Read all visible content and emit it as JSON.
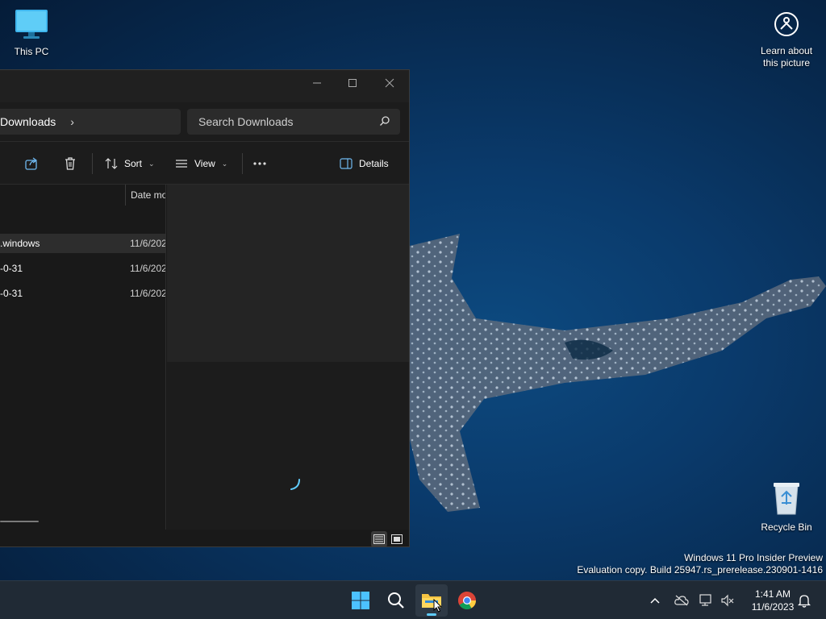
{
  "desktop": {
    "this_pc_label": "This PC",
    "learn_label_1": "Learn about",
    "learn_label_2": "this picture",
    "recycle_bin_label": "Recycle Bin",
    "watermark_line1": "Windows 11 Pro Insider Preview",
    "watermark_line2": "Evaluation copy. Build 25947.rs_prerelease.230901-1416"
  },
  "explorer": {
    "address_crumb": "Downloads",
    "search_placeholder": "Search Downloads",
    "toolbar": {
      "sort_label": "Sort",
      "view_label": "View",
      "details_label": "Details"
    },
    "columns": {
      "date_modified": "Date mo"
    },
    "rows": [
      {
        "name": ".windows",
        "date": "11/6/202",
        "selected": true
      },
      {
        "name": "-0-31",
        "date": "11/6/202",
        "selected": false
      },
      {
        "name": "-0-31",
        "date": "11/6/202",
        "selected": false
      }
    ]
  },
  "taskbar": {
    "time": "1:41 AM",
    "date": "11/6/2023",
    "apps": [
      "start",
      "search",
      "file-explorer",
      "chrome"
    ]
  },
  "colors": {
    "accent": "#60cdff",
    "window_bg": "#191919",
    "taskbar_bg": "#202a35"
  }
}
